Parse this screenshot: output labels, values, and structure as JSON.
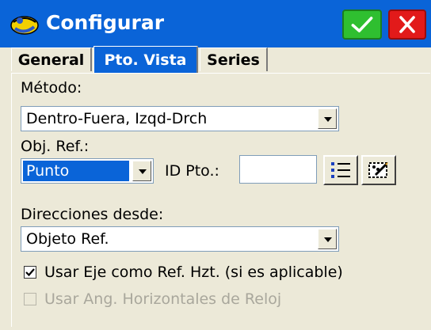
{
  "window": {
    "title": "Configurar",
    "ok_icon": "checkmark-icon",
    "close_icon": "close-icon",
    "colors": {
      "titlebar": "#0a64d8",
      "ok": "#2fbf30",
      "close": "#e21a1a"
    }
  },
  "tabs": [
    {
      "label": "General",
      "active": false
    },
    {
      "label": "Pto. Vista",
      "active": true
    },
    {
      "label": "Series",
      "active": false
    }
  ],
  "form": {
    "metodo_label": "Método:",
    "metodo_value": "Dentro-Fuera, Izqd-Drch",
    "objref_label": "Obj. Ref.:",
    "objref_value": "Punto",
    "idpto_label": "ID Pto.:",
    "idpto_value": "",
    "list_icon": "list-icon",
    "map_icon": "map-select-icon",
    "direcciones_label": "Direcciones desde:",
    "direcciones_value": "Objeto Ref.",
    "usar_eje_label": "Usar Eje como Ref. Hzt. (si es aplicable)",
    "usar_eje_checked": true,
    "usar_ang_label": "Usar Ang. Horizontales de Reloj",
    "usar_ang_checked": false,
    "usar_ang_enabled": false
  }
}
